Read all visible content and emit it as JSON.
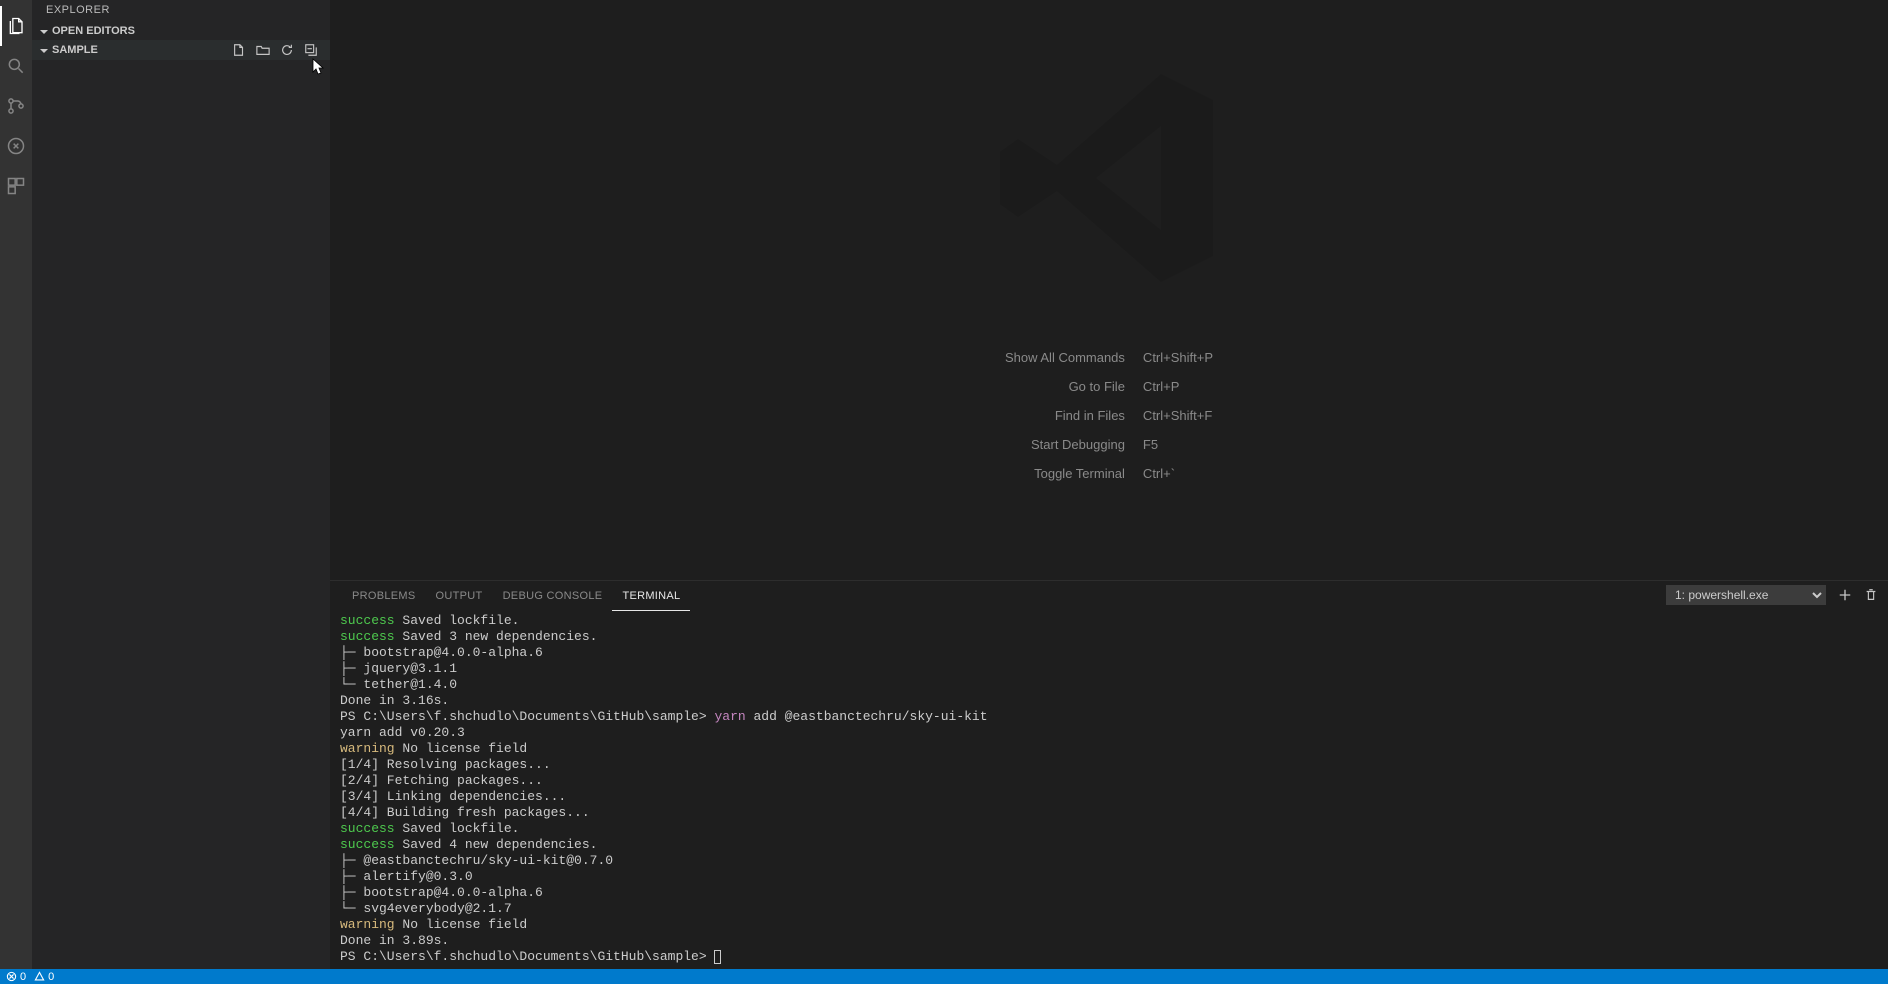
{
  "sidebar": {
    "title": "EXPLORER",
    "sections": {
      "open_editors": "OPEN EDITORS",
      "folder": "SAMPLE"
    }
  },
  "welcome": {
    "commands": [
      {
        "label": "Show All Commands",
        "key": "Ctrl+Shift+P"
      },
      {
        "label": "Go to File",
        "key": "Ctrl+P"
      },
      {
        "label": "Find in Files",
        "key": "Ctrl+Shift+F"
      },
      {
        "label": "Start Debugging",
        "key": "F5"
      },
      {
        "label": "Toggle Terminal",
        "key": "Ctrl+`"
      }
    ]
  },
  "panel": {
    "tabs": {
      "problems": "PROBLEMS",
      "output": "OUTPUT",
      "debug_console": "DEBUG CONSOLE",
      "terminal": "TERMINAL"
    },
    "terminal_select": "1: powershell.exe"
  },
  "terminal": {
    "lines": [
      {
        "c": "success",
        "t1": "success",
        "t2": " Saved lockfile."
      },
      {
        "c": "success",
        "t1": "success",
        "t2": " Saved 3 new dependencies."
      },
      {
        "c": "default",
        "t": "├─ bootstrap@4.0.0-alpha.6"
      },
      {
        "c": "default",
        "t": "├─ jquery@3.1.1"
      },
      {
        "c": "default",
        "t": "└─ tether@1.4.0"
      },
      {
        "c": "default",
        "t": "Done in 3.16s."
      },
      {
        "c": "prompt",
        "p": "PS C:\\Users\\f.shchudlo\\Documents\\GitHub\\sample> ",
        "cmd1": "yarn",
        "cmd2": " add @eastbanctechru/sky-ui-kit"
      },
      {
        "c": "default",
        "t": "yarn add v0.20.3"
      },
      {
        "c": "warning",
        "t1": "warning",
        "t2": " No license field"
      },
      {
        "c": "default",
        "t": "[1/4] Resolving packages..."
      },
      {
        "c": "default",
        "t": "[2/4] Fetching packages..."
      },
      {
        "c": "default",
        "t": "[3/4] Linking dependencies..."
      },
      {
        "c": "default",
        "t": "[4/4] Building fresh packages..."
      },
      {
        "c": "success",
        "t1": "success",
        "t2": " Saved lockfile."
      },
      {
        "c": "success",
        "t1": "success",
        "t2": " Saved 4 new dependencies."
      },
      {
        "c": "default",
        "t": "├─ @eastbanctechru/sky-ui-kit@0.7.0"
      },
      {
        "c": "default",
        "t": "├─ alertify@0.3.0"
      },
      {
        "c": "default",
        "t": "├─ bootstrap@4.0.0-alpha.6"
      },
      {
        "c": "default",
        "t": "└─ svg4everybody@2.1.7"
      },
      {
        "c": "warning",
        "t1": "warning",
        "t2": " No license field"
      },
      {
        "c": "default",
        "t": "Done in 3.89s."
      },
      {
        "c": "prompt_cursor",
        "p": "PS C:\\Users\\f.shchudlo\\Documents\\GitHub\\sample> "
      }
    ]
  },
  "status": {
    "errors": "0",
    "warnings": "0"
  }
}
